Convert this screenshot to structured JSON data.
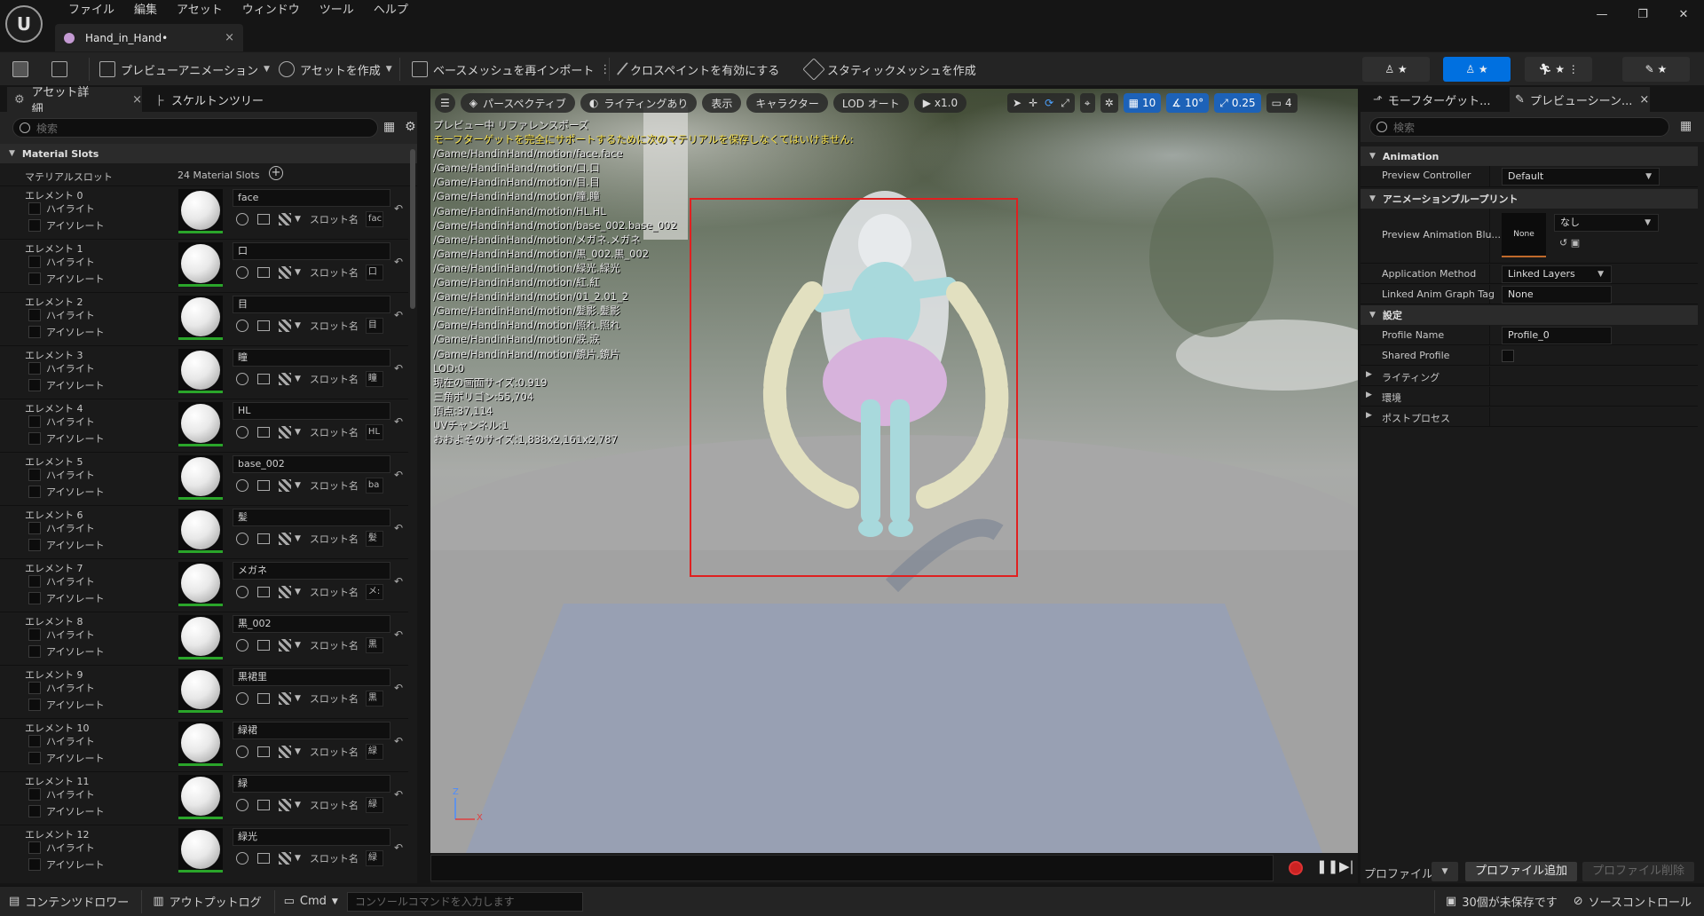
{
  "menu": [
    "ファイル",
    "編集",
    "アセット",
    "ウィンドウ",
    "ツール",
    "ヘルプ"
  ],
  "doc_tab": {
    "title": "Hand_in_Hand•",
    "close": "×"
  },
  "window_controls": {
    "minimize": "—",
    "restore": "❐",
    "close": "✕"
  },
  "toolbar": {
    "preview_anim": "プレビューアニメーション",
    "create_asset": "アセットを作成",
    "reimport": "ベースメッシュを再インポート",
    "cloth_paint": "クロスペイントを有効にする",
    "make_static": "スタティックメッシュを作成"
  },
  "left_panel": {
    "tab_details": "アセット詳細",
    "tab_tree": "スケルトンツリー",
    "search_placeholder": "検索",
    "category": "Material Slots",
    "material_slots_label": "マテリアルスロット",
    "material_count": "24 Material Slots",
    "highlight": "ハイライト",
    "isolate": "アイソレート",
    "slot_name_label": "スロット名",
    "elements": [
      {
        "label": "エレメント 0",
        "material": "face",
        "slot": "fac"
      },
      {
        "label": "エレメント 1",
        "material": "口",
        "slot": "口"
      },
      {
        "label": "エレメント 2",
        "material": "目",
        "slot": "目"
      },
      {
        "label": "エレメント 3",
        "material": "瞳",
        "slot": "瞳"
      },
      {
        "label": "エレメント 4",
        "material": "HL",
        "slot": "HL"
      },
      {
        "label": "エレメント 5",
        "material": "base_002",
        "slot": "ba"
      },
      {
        "label": "エレメント 6",
        "material": "髪",
        "slot": "髪"
      },
      {
        "label": "エレメント 7",
        "material": "メガネ",
        "slot": "メ:"
      },
      {
        "label": "エレメント 8",
        "material": "黒_002",
        "slot": "黒"
      },
      {
        "label": "エレメント 9",
        "material": "黒裙里",
        "slot": "黒"
      },
      {
        "label": "エレメント 10",
        "material": "緑裙",
        "slot": "緑"
      },
      {
        "label": "エレメント 11",
        "material": "緑",
        "slot": "緑"
      },
      {
        "label": "エレメント 12",
        "material": "緑光",
        "slot": "緑"
      }
    ]
  },
  "viewport": {
    "perspective": "パースペクティブ",
    "lighting": "ライティングあり",
    "show": "表示",
    "character": "キャラクター",
    "lod": "LOD オート",
    "speed": "x1.0",
    "grid": "10",
    "angle": "10°",
    "scale": "0.25",
    "cam": "4",
    "overlay_title": "プレビュー中 リファレンスポーズ",
    "overlay_warning": "モーフターゲットを完全にサポートするために次のマテリアルを保存しなくてはいけません:",
    "overlay_paths": [
      "/Game/HandinHand/motion/face.face",
      "/Game/HandinHand/motion/口.口",
      "/Game/HandinHand/motion/目.目",
      "/Game/HandinHand/motion/瞳.瞳",
      "/Game/HandinHand/motion/HL.HL",
      "/Game/HandinHand/motion/base_002.base_002",
      "/Game/HandinHand/motion/メガネ.メガネ",
      "/Game/HandinHand/motion/黒_002.黒_002",
      "/Game/HandinHand/motion/緑光.緑光",
      "/Game/HandinHand/motion/紅.紅",
      "/Game/HandinHand/motion/01_2.01_2",
      "/Game/HandinHand/motion/髪影.髪影",
      "/Game/HandinHand/motion/照れ.照れ",
      "/Game/HandinHand/motion/涙.涙",
      "/Game/HandinHand/motion/鏡片.鏡片"
    ],
    "overlay_stats": [
      "LOD:0",
      "現在の画面サイズ:0.919",
      "三角ポリゴン:55,704",
      "頂点:37,114",
      "UVチャンネル:1",
      "おおよそのサイズ:1,838x2,161x2,787"
    ],
    "axis_z": "Z",
    "axis_x": "X"
  },
  "right_panel": {
    "tab_morph": "モーフターゲット...",
    "tab_scene": "プレビューシーン...",
    "search_placeholder": "検索",
    "cat_animation": "Animation",
    "preview_controller_label": "Preview Controller",
    "preview_controller_value": "Default",
    "cat_blueprint": "アニメーションブループリント",
    "preview_anim_bp_label": "Preview Animation Blu...",
    "anim_bp_thumb": "None",
    "anim_bp_value": "なし",
    "application_method_label": "Application Method",
    "application_method_value": "Linked Layers",
    "linked_tag_label": "Linked Anim Graph Tag",
    "linked_tag_value": "None",
    "cat_settings": "設定",
    "profile_name_label": "Profile Name",
    "profile_name_value": "Profile_0",
    "shared_profile_label": "Shared Profile",
    "cat_lighting": "ライティング",
    "cat_environment": "環境",
    "cat_postprocess": "ポストプロセス",
    "profile_label": "プロファイル",
    "add_profile": "プロファイル追加",
    "remove_profile": "プロファイル削除"
  },
  "statusbar": {
    "content_drawer": "コンテンツドロワー",
    "output_log": "アウトプットログ",
    "cmd": "Cmd",
    "console_placeholder": "コンソールコマンドを入力します",
    "unsaved": "30個が未保存です",
    "source_control": "ソースコントロール"
  },
  "colors": {
    "accent": "#0070e0",
    "selection": "#e02020",
    "warning": "#f6e04a",
    "thumb_underline": "#2aa52a"
  }
}
